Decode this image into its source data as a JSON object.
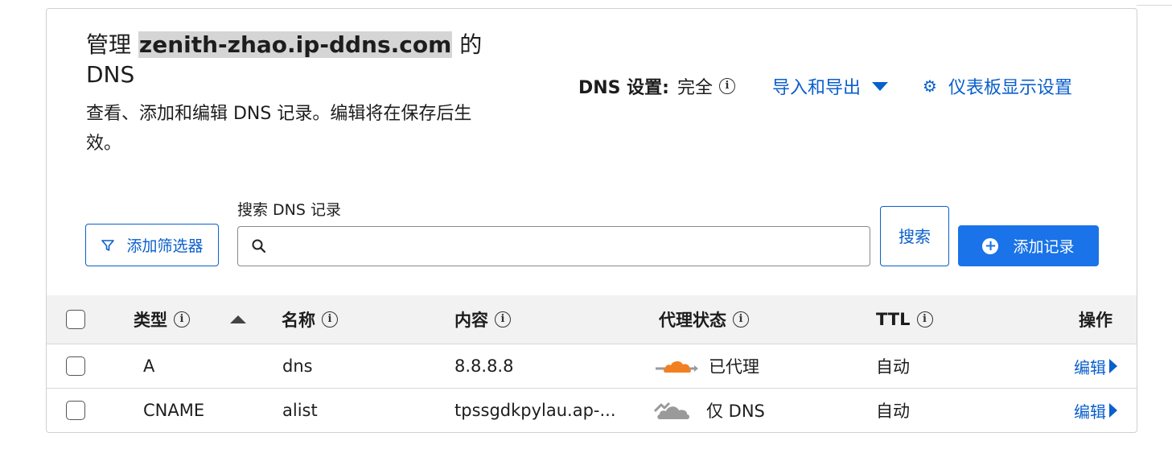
{
  "header": {
    "title_prefix": "管理",
    "domain": "zenith-zhao.ip-ddns.com",
    "title_suffix": "的",
    "title_line2": "DNS",
    "subtitle": "查看、添加和编辑 DNS 记录。编辑将在保存后生效。"
  },
  "settings": {
    "dns_label": "DNS 设置:",
    "dns_value": "完全",
    "import_export": "导入和导出",
    "dashboard_display": "仪表板显示设置"
  },
  "toolbar": {
    "filter_button": "添加筛选器",
    "search_label": "搜索 DNS 记录",
    "search_value": "",
    "search_button": "搜索",
    "add_record_button": "添加记录"
  },
  "table": {
    "columns": {
      "type": "类型",
      "name": "名称",
      "content": "内容",
      "proxy_status": "代理状态",
      "ttl": "TTL",
      "actions": "操作"
    },
    "rows": [
      {
        "type": "A",
        "name": "dns",
        "content": "8.8.8.8",
        "proxy_status": "已代理",
        "proxy_icon": "cloud-proxied-icon",
        "ttl": "自动",
        "action": "编辑"
      },
      {
        "type": "CNAME",
        "name": "alist",
        "content": "tpssgdkpylau.ap-...",
        "proxy_status": "仅 DNS",
        "proxy_icon": "cloud-dns-only-icon",
        "ttl": "自动",
        "action": "编辑"
      }
    ]
  },
  "colors": {
    "link": "#0a5fcc",
    "primary_button": "#1a73e8",
    "proxied_cloud": "#f38020",
    "dns_only_cloud": "#9a9a9a",
    "header_row_bg": "#f2f2f2"
  }
}
